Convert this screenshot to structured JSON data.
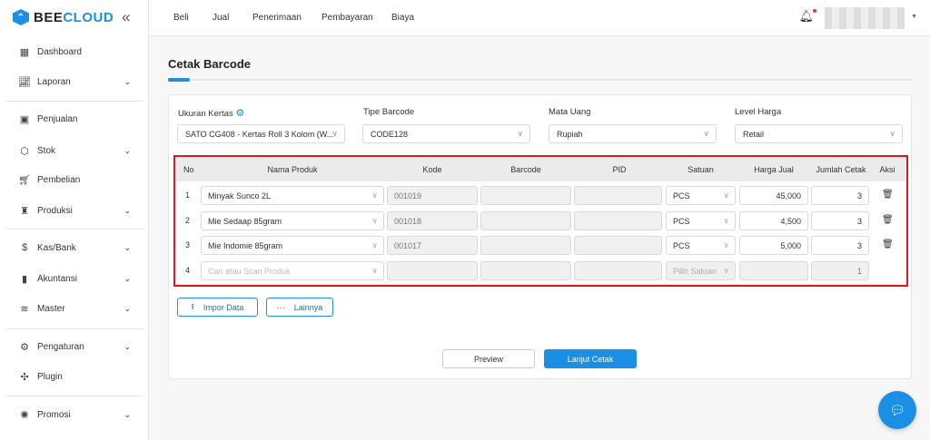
{
  "brand": {
    "bee": "BEE",
    "cloud": "CLOUD"
  },
  "sidebar": {
    "items": [
      {
        "label": "Dashboard",
        "icon": "grid-icon",
        "chev": false
      },
      {
        "label": "Laporan",
        "icon": "chart-line-icon",
        "chev": true
      },
      {
        "label": "Penjualan",
        "icon": "shopping-bag-icon",
        "chev": false
      },
      {
        "label": "Stok",
        "icon": "box-icon",
        "chev": true
      },
      {
        "label": "Pembelian",
        "icon": "cart-icon",
        "chev": false
      },
      {
        "label": "Produksi",
        "icon": "factory-icon",
        "chev": true
      },
      {
        "label": "Kas/Bank",
        "icon": "cash-icon",
        "chev": true
      },
      {
        "label": "Akuntansi",
        "icon": "bar-chart-icon",
        "chev": true
      },
      {
        "label": "Master",
        "icon": "database-icon",
        "chev": true
      },
      {
        "label": "Pengaturan",
        "icon": "gear-icon",
        "chev": true
      },
      {
        "label": "Plugin",
        "icon": "puzzle-icon",
        "chev": false
      },
      {
        "label": "Promosi",
        "icon": "badge-icon",
        "chev": true
      }
    ]
  },
  "topnav": [
    "Beli",
    "Jual",
    "Penerimaan",
    "Pembayaran",
    "Biaya"
  ],
  "page": {
    "title": "Cetak Barcode"
  },
  "filters": {
    "paper_label": "Ukuran Kertas",
    "paper_value": "SATO CG408 - Kertas Roll 3 Kolom (W...",
    "type_label": "Tipe Barcode",
    "type_value": "CODE128",
    "currency_label": "Mata Uang",
    "currency_value": "Rupiah",
    "price_label": "Level Harga",
    "price_value": "Retail"
  },
  "table": {
    "headers": [
      "No",
      "Nama Produk",
      "Kode",
      "Barcode",
      "PID",
      "Satuan",
      "Harga Jual",
      "Jumlah Cetak",
      "Aksi"
    ],
    "rows": [
      {
        "no": "1",
        "name": "Minyak Sunco 2L",
        "code": "001019",
        "unit": "PCS",
        "price": "45,000",
        "qty": "3"
      },
      {
        "no": "2",
        "name": "Mie Sedaap 85gram",
        "code": "001018",
        "unit": "PCS",
        "price": "4,500",
        "qty": "3"
      },
      {
        "no": "3",
        "name": "Mie Indomie 85gram",
        "code": "001017",
        "unit": "PCS",
        "price": "5,000",
        "qty": "3"
      }
    ],
    "new_row": {
      "no": "4",
      "name_placeholder": "Cari atau Scan Produk",
      "unit_placeholder": "Pilih Satuan",
      "qty": "1"
    }
  },
  "actions": {
    "import": "Impor Data",
    "more": "Lainnya",
    "preview": "Preview",
    "continue": "Lanjut Cetak"
  },
  "colors": {
    "accent": "#1a8fe3",
    "highlight": "#e0141b"
  }
}
